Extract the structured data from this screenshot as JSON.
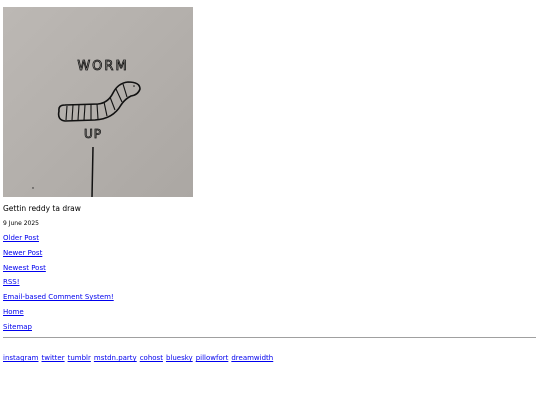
{
  "post": {
    "image_alt": "drawing of a worm",
    "image_text_top": "WORM",
    "image_text_bottom": "UP",
    "caption": "Gettin reddy ta draw",
    "date": "9 June 2025"
  },
  "nav": {
    "older": "Older Post",
    "newer": "Newer Post",
    "newest": "Newest Post",
    "rss": "RSS!",
    "comments": "Email-based Comment System!",
    "home": "Home",
    "sitemap": "Sitemap"
  },
  "socials": [
    "instagram",
    "twitter",
    "tumblr",
    "mstdn.party",
    "cohost",
    "bluesky",
    "pillowfort",
    "dreamwidth"
  ],
  "colors": {
    "link": "#0000ee",
    "paper": "#b4b0ac",
    "rule": "#a0a0a0"
  }
}
